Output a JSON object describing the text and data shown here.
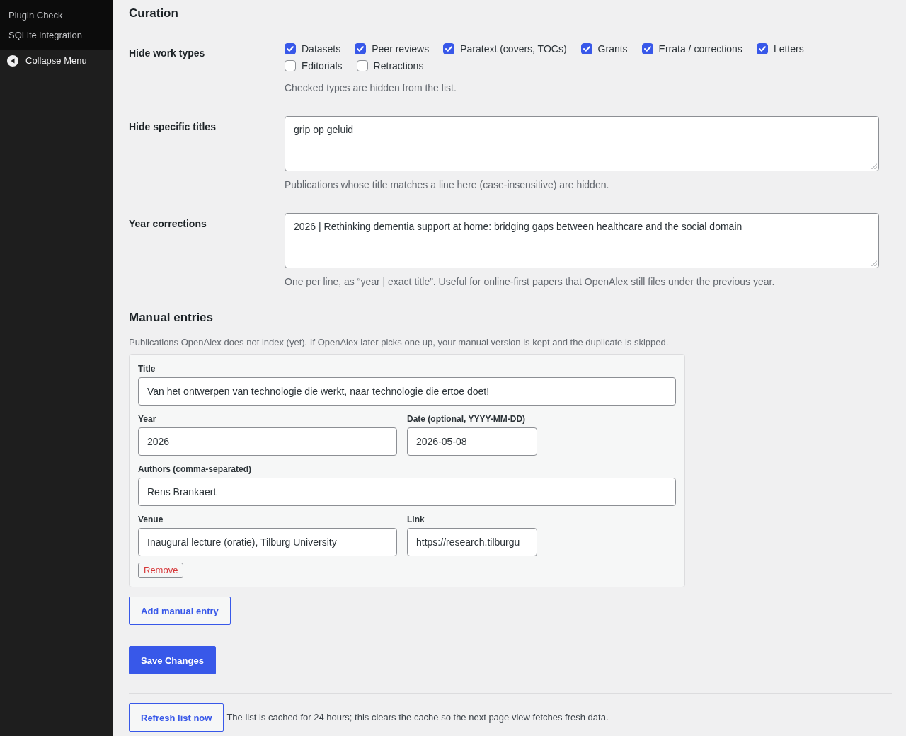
{
  "sidebar": {
    "submenu": [
      {
        "label": "Plugin Check"
      },
      {
        "label": "SQLite integration"
      }
    ],
    "collapse": {
      "label": "Collapse Menu"
    }
  },
  "curation": {
    "heading": "Curation",
    "rows": [
      {
        "kind": "checkboxes",
        "label": "Hide work types",
        "options": [
          {
            "label": "Datasets",
            "checked": true
          },
          {
            "label": "Peer reviews",
            "checked": true
          },
          {
            "label": "Paratext (covers, TOCs)",
            "checked": true
          },
          {
            "label": "Grants",
            "checked": true
          },
          {
            "label": "Errata / corrections",
            "checked": true
          },
          {
            "label": "Letters",
            "checked": true
          },
          {
            "label": "Editorials",
            "checked": false
          },
          {
            "label": "Retractions",
            "checked": false
          }
        ],
        "description": "Checked types are hidden from the list."
      },
      {
        "kind": "textarea",
        "label": "Hide specific titles",
        "value": "grip op geluid",
        "description": "Publications whose title matches a line here (case-insensitive) are hidden."
      },
      {
        "kind": "textarea",
        "label": "Year corrections",
        "value": "2026 | Rethinking dementia support at home: bridging gaps between healthcare and the social domain",
        "description": "One per line, as “year | exact title”. Useful for online-first papers that OpenAlex still files under the previous year."
      }
    ]
  },
  "manual_entries": {
    "heading": "Manual entries",
    "description": "Publications OpenAlex does not index (yet). If OpenAlex later picks one up, your manual version is kept and the duplicate is skipped.",
    "entries": [
      {
        "title": {
          "label": "Title",
          "value": "Van het ontwerpen van technologie die werkt, naar technologie die ertoe doet!"
        },
        "year": {
          "label": "Year",
          "value": "2026"
        },
        "date": {
          "label": "Date (optional, YYYY-MM-DD)",
          "value": "2026-05-08"
        },
        "authors": {
          "label": "Authors (comma-separated)",
          "value": "Rens Brankaert"
        },
        "venue": {
          "label": "Venue",
          "value": "Inaugural lecture (oratie), Tilburg University"
        },
        "link": {
          "label": "Link",
          "value": "https://research.tilburgu"
        },
        "remove_button": "Remove"
      }
    ],
    "add_button": "Add manual entry"
  },
  "save_button": "Save Changes",
  "refresh": {
    "button": "Refresh list now",
    "note": "The list is cached for 24 hours; this clears the cache so the next page view fetches fresh data."
  }
}
